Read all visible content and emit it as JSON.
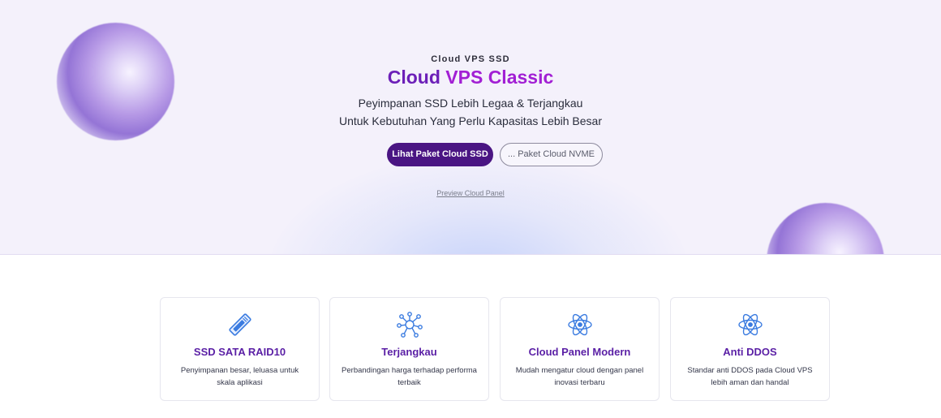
{
  "hero": {
    "eyebrow": "Cloud VPS SSD",
    "title_part1": "Cloud ",
    "title_part2": "VPS Classic",
    "subtitle_line1": "Peyimpanan SSD Lebih Legaa & Terjangkau",
    "subtitle_line2": "Untuk Kebutuhan Yang Perlu Kapasitas Lebih Besar",
    "primary_button": "Lihat Paket Cloud SSD",
    "secondary_button": "... Paket Cloud NVME",
    "preview_link": "Preview Cloud Panel"
  },
  "features": [
    {
      "icon": "ssd-drive-icon",
      "title": "SSD SATA RAID10",
      "description": "Penyimpanan besar, leluasa untuk skala aplikasi"
    },
    {
      "icon": "network-hub-icon",
      "title": "Terjangkau",
      "description": "Perbandingan harga terhadap performa terbaik"
    },
    {
      "icon": "atom-icon",
      "title": "Cloud Panel Modern",
      "description": "Mudah mengatur cloud dengan panel inovasi terbaru"
    },
    {
      "icon": "atom-icon",
      "title": "Anti DDOS",
      "description": "Standar anti DDOS pada Cloud VPS lebih aman dan handal"
    }
  ],
  "colors": {
    "brand_primary": "#4a1583",
    "title_purple": "#6c1fb8",
    "title_magenta": "#a21fd4",
    "icon_blue": "#3a7be0",
    "hero_bg": "#f4f1fb"
  }
}
